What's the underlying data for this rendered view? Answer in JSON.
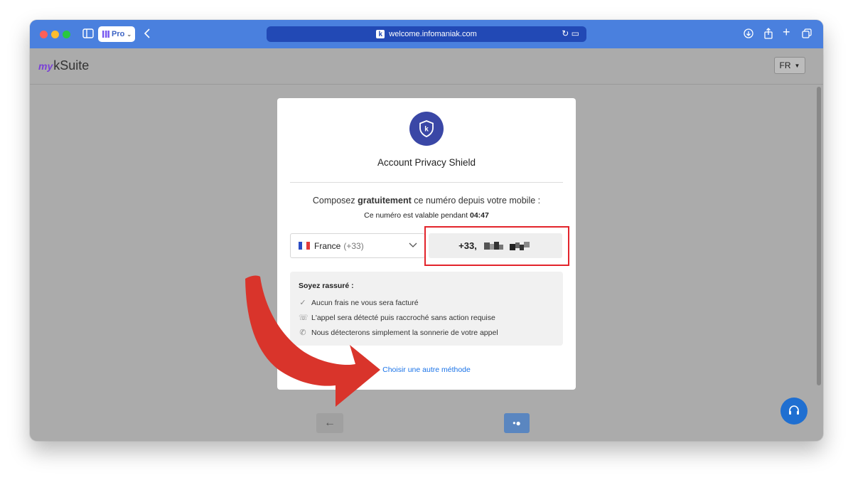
{
  "browser": {
    "pro_label": "Pro",
    "url": "welcome.infomaniak.com"
  },
  "header": {
    "logo_my": "my",
    "logo_suite": "kSuite",
    "language": "FR"
  },
  "card": {
    "title": "Account Privacy Shield",
    "instruction_pre": "Composez ",
    "instruction_bold": "gratuitement",
    "instruction_post": " ce numéro depuis votre mobile :",
    "validity_label": "Ce numéro est valable pendant",
    "validity_time": "04:47",
    "country_name": "France",
    "country_code": "(+33)",
    "phone_prefix": "+33,",
    "reassure_title": "Soyez rassuré :",
    "reassure_items": [
      {
        "icon": "check-icon",
        "text": "Aucun frais ne vous sera facturé"
      },
      {
        "icon": "phone-detect-icon",
        "text": "L'appel sera détecté puis raccroché sans action requise"
      },
      {
        "icon": "phone-ring-icon",
        "text": "Nous détecterons simplement la sonnerie de votre appel"
      }
    ],
    "alt_method": "Choisir une autre méthode"
  },
  "colors": {
    "accent": "#3a47a6",
    "link": "#1a73e8",
    "highlight": "#e3242b",
    "arrow": "#d9342b"
  }
}
